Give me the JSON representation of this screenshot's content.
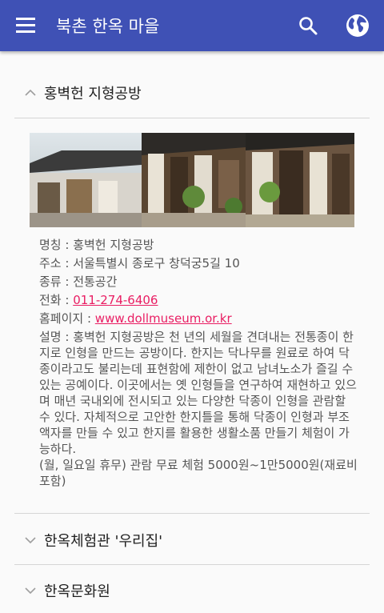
{
  "app": {
    "title": "북촌 한옥 마을"
  },
  "icons": {
    "menu": "menu-icon",
    "search": "search-icon",
    "globe": "globe-icon"
  },
  "colors": {
    "appbar": "#3f51b5",
    "link": "#e91e63"
  },
  "sections": [
    {
      "title": "홍벽헌 지형공방",
      "expanded": true
    },
    {
      "title": "한옥체험관 '우리집'",
      "expanded": false
    },
    {
      "title": "한옥문화원",
      "expanded": false
    }
  ],
  "detail": {
    "name_label": "명칭 : ",
    "name": "홍벽헌 지형공방",
    "address_label": "주소 : ",
    "address": "서울특별시 종로구 창덕궁5길 10",
    "type_label": "종류 : ",
    "type": "전통공간",
    "phone_label": "전화 : ",
    "phone": "011-274-6406",
    "homepage_label": "홈페이지 : ",
    "homepage": "www.dollmuseum.or.kr",
    "description": "설명 : 홍벽헌 지형공방은 천 년의 세월을 견뎌내는 전통종이 한지로 인형을 만드는 공방이다. 한지는 닥나무를 원료로 하여 닥종이라고도 불리는데 표현함에 제한이 없고 남녀노소가 즐길 수 있는 공예이다. 이곳에서는 옛 인형들을 연구하여 재현하고 있으며 매년 국내외에 전시되고 있는 다양한 닥종이 인형을 관람할 수 있다. 자체적으로 고안한 한지틀을 통해 닥종이 인형과 부조액자를 만들 수 있고 한지를 활용한 생활소품 만들기 체험이 가능하다.",
    "fee": "(월, 일요일 휴무) 관람 무료 체험 5000원~1만5000원(재료비 포함)"
  }
}
